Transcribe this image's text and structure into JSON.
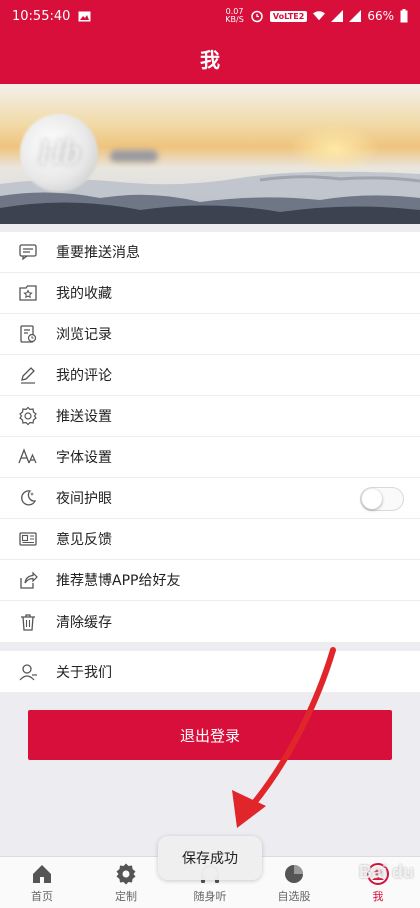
{
  "status_bar": {
    "time": "10:55:40",
    "speed_top": "0.07",
    "speed_bottom": "KB/S",
    "volte": "VoLTE2",
    "battery": "66%"
  },
  "header": {
    "title": "我"
  },
  "menu": {
    "items": [
      {
        "label": "重要推送消息",
        "icon": "message-icon"
      },
      {
        "label": "我的收藏",
        "icon": "favorite-folder-icon"
      },
      {
        "label": "浏览记录",
        "icon": "history-icon"
      },
      {
        "label": "我的评论",
        "icon": "pen-icon"
      },
      {
        "label": "推送设置",
        "icon": "gear-icon"
      },
      {
        "label": "字体设置",
        "icon": "font-icon"
      },
      {
        "label": "夜间护眼",
        "icon": "moon-icon",
        "toggle": false
      },
      {
        "label": "意见反馈",
        "icon": "feedback-icon"
      },
      {
        "label": "推荐慧博APP给好友",
        "icon": "share-icon"
      },
      {
        "label": "清除缓存",
        "icon": "trash-icon"
      }
    ],
    "about": {
      "label": "关于我们",
      "icon": "user-icon"
    }
  },
  "logout_label": "退出登录",
  "toast": "保存成功",
  "tabs": [
    {
      "label": "首页",
      "icon": "home-icon"
    },
    {
      "label": "定制",
      "icon": "gear-icon"
    },
    {
      "label": "随身听",
      "icon": "headphones-icon"
    },
    {
      "label": "自选股",
      "icon": "pie-icon"
    },
    {
      "label": "我",
      "icon": "me-icon",
      "active": true
    }
  ],
  "watermark": "Bai du",
  "accent": "#d80f3a"
}
